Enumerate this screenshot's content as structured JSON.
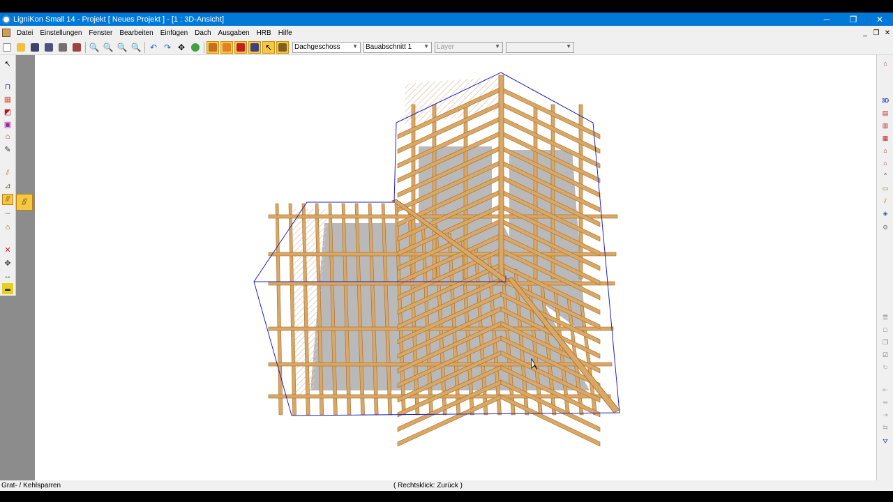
{
  "titlebar": {
    "title": "LigniKon Small 14 - Projekt [ Neues Projekt ]  - [1 : 3D-Ansicht]",
    "minimize": "─",
    "restore": "❐",
    "close": "✕"
  },
  "menubar": {
    "items": [
      "Datei",
      "Einstellungen",
      "Fenster",
      "Bearbeiten",
      "Einfügen",
      "Dach",
      "Ausgaben",
      "HRB",
      "Hilfe"
    ],
    "mdi_minimize": "_",
    "mdi_restore": "❐",
    "mdi_close": "✕"
  },
  "toolbar": {
    "floor_select": "Dachgeschoss",
    "section_select": "Bauabschnitt 1",
    "layer_select": "Layer",
    "extra_select": ""
  },
  "status": {
    "left": "Grat- / Kehlsparren",
    "center": "( Rechtsklick: Zurück )"
  },
  "colors": {
    "titlebar": "#0078d7",
    "timber": "#d9a865",
    "timber_dark": "#a86a2a",
    "insulation": "#b9b9b9",
    "outline": "#2020c0"
  }
}
